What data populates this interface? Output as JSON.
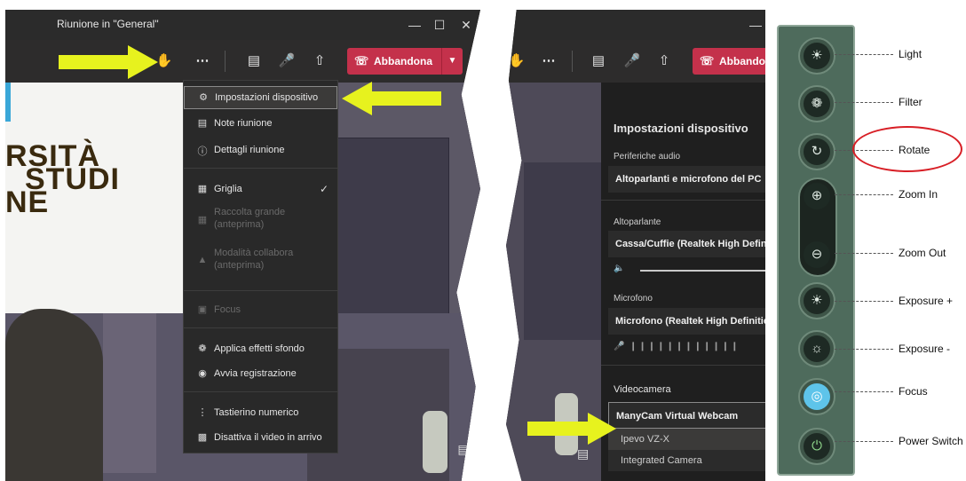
{
  "left_window": {
    "title": "Riunione in \"General\"",
    "leave_label": "Abbandona",
    "scene_text": [
      "RSITÀ",
      "STUDI",
      "NE"
    ],
    "menu": [
      {
        "label": "Impostazioni dispositivo",
        "icon": "gear-icon",
        "highlighted": true
      },
      {
        "label": "Note riunione",
        "icon": "notes-icon"
      },
      {
        "label": "Dettagli riunione",
        "icon": "info-icon"
      },
      {
        "label": "Griglia",
        "icon": "grid-icon",
        "checked": true
      },
      {
        "label": "Raccolta grande",
        "sub": "(anteprima)",
        "icon": "large-gallery-icon",
        "disabled": true
      },
      {
        "label": "Modalità collabora",
        "sub": "(anteprima)",
        "icon": "together-mode-icon",
        "disabled": true
      },
      {
        "label": "Focus",
        "icon": "focus-icon",
        "disabled": true
      },
      {
        "label": "Applica effetti sfondo",
        "icon": "background-effects-icon"
      },
      {
        "label": "Avvia registrazione",
        "icon": "record-icon"
      },
      {
        "label": "Tastierino numerico",
        "icon": "keypad-icon"
      },
      {
        "label": "Disattiva il video in arrivo",
        "icon": "video-off-icon"
      }
    ]
  },
  "settings_window": {
    "leave_label": "Abbandona",
    "heading": "Impostazioni dispositivo",
    "audio_label": "Periferiche audio",
    "audio_value": "Altoparlanti e microfono del PC",
    "speaker_label": "Altoparlante",
    "speaker_value": "Cassa/Cuffie (Realtek High Definition Audio)",
    "mic_label": "Microfono",
    "mic_value": "Microfono (Realtek High Definition Audio)",
    "camera_label": "Videocamera",
    "camera_value": "ManyCam Virtual Webcam",
    "camera_options": [
      "Ipevo VZ-X",
      "Integrated Camera"
    ]
  },
  "device": {
    "labels": [
      "Light",
      "Filter",
      "Rotate",
      "Zoom In",
      "Zoom Out",
      "Exposure +",
      "Exposure -",
      "Focus",
      "Power Switch"
    ],
    "highlight_color": "#d81f26",
    "focus_color": "#5ec4ea"
  },
  "arrow_color": "#e7f21e"
}
